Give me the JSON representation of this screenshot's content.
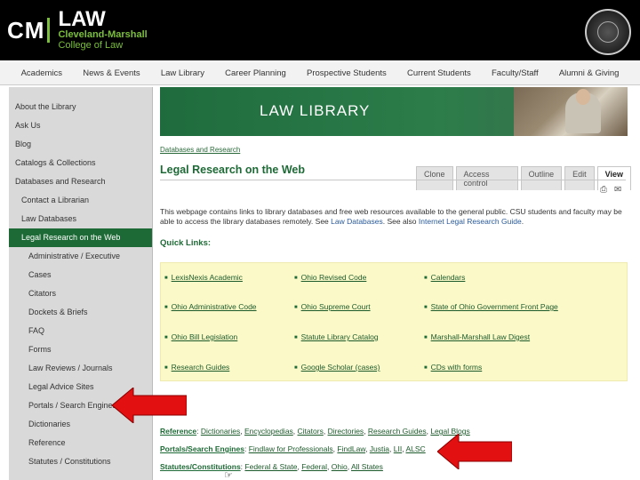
{
  "header": {
    "logo_cm": "CM",
    "logo_law": "LAW",
    "logo_sub1": "Cleveland-Marshall",
    "logo_sub2": "College of Law"
  },
  "nav": [
    "Academics",
    "News & Events",
    "Law Library",
    "Career Planning",
    "Prospective Students",
    "Current Students",
    "Faculty/Staff",
    "Alumni & Giving"
  ],
  "sidebar": [
    {
      "label": "About the Library",
      "level": 0
    },
    {
      "label": "Ask Us",
      "level": 0
    },
    {
      "label": "Blog",
      "level": 0
    },
    {
      "label": "Catalogs & Collections",
      "level": 0
    },
    {
      "label": "Databases and Research",
      "level": 0
    },
    {
      "label": "Contact a Librarian",
      "level": 1
    },
    {
      "label": "Law Databases",
      "level": 1
    },
    {
      "label": "Legal Research on the Web",
      "level": 1,
      "active": true
    },
    {
      "label": "Administrative / Executive",
      "level": 2
    },
    {
      "label": "Cases",
      "level": 2
    },
    {
      "label": "Citators",
      "level": 2
    },
    {
      "label": "Dockets & Briefs",
      "level": 2
    },
    {
      "label": "FAQ",
      "level": 2
    },
    {
      "label": "Forms",
      "level": 2
    },
    {
      "label": "Law Reviews / Journals",
      "level": 2
    },
    {
      "label": "Legal Advice Sites",
      "level": 2
    },
    {
      "label": "Portals / Search Engines",
      "level": 2
    },
    {
      "label": "Dictionaries",
      "level": 2
    },
    {
      "label": "Reference",
      "level": 2
    },
    {
      "label": "Statutes / Constitutions",
      "level": 2
    }
  ],
  "banner_title": "LAW LIBRARY",
  "breadcrumb": "Databases and Research",
  "page_title": "Legal Research on the Web",
  "tabs": [
    "Clone",
    "Access control",
    "Outline",
    "Edit",
    "View"
  ],
  "selected_tab": "View",
  "intro": {
    "text1": "This webpage contains links to library databases and free web resources available to the general public. CSU students and faculty may be able to access the library databases remotely. See ",
    "link1": "Law Databases",
    "text2": ". See also ",
    "link2": "Internet Legal Research Guide",
    "text3": "."
  },
  "quick_links_label": "Quick Links:",
  "quick_links": [
    [
      "LexisNexis Academic",
      "Ohio Revised Code",
      "Calendars"
    ],
    [
      "Ohio Administrative Code",
      "Ohio Supreme Court",
      "State of Ohio Government Front Page"
    ],
    [
      "Ohio Bill Legislation",
      "Statute Library Catalog",
      "Marshall-Marshall Law Digest"
    ],
    [
      "Research Guides",
      "Google Scholar (cases)",
      "CDs with forms"
    ]
  ],
  "more": [
    {
      "label": "Reference",
      "items": [
        "Dictionaries",
        "Encyclopedias",
        "Citators",
        "Directories",
        "Research Guides",
        "Legal Blogs"
      ]
    },
    {
      "label": "Portals/Search Engines",
      "items": [
        "Findlaw for Professionals",
        "FindLaw",
        "Justia",
        "LII",
        "ALSC"
      ]
    },
    {
      "label": "Statutes/Constitutions",
      "items": [
        "Federal & State",
        "Federal",
        "Ohio",
        "All States"
      ]
    }
  ],
  "colors": {
    "green": "#1e6a36",
    "arrow": "#e21010",
    "quick_bg": "#fbf9c8"
  }
}
